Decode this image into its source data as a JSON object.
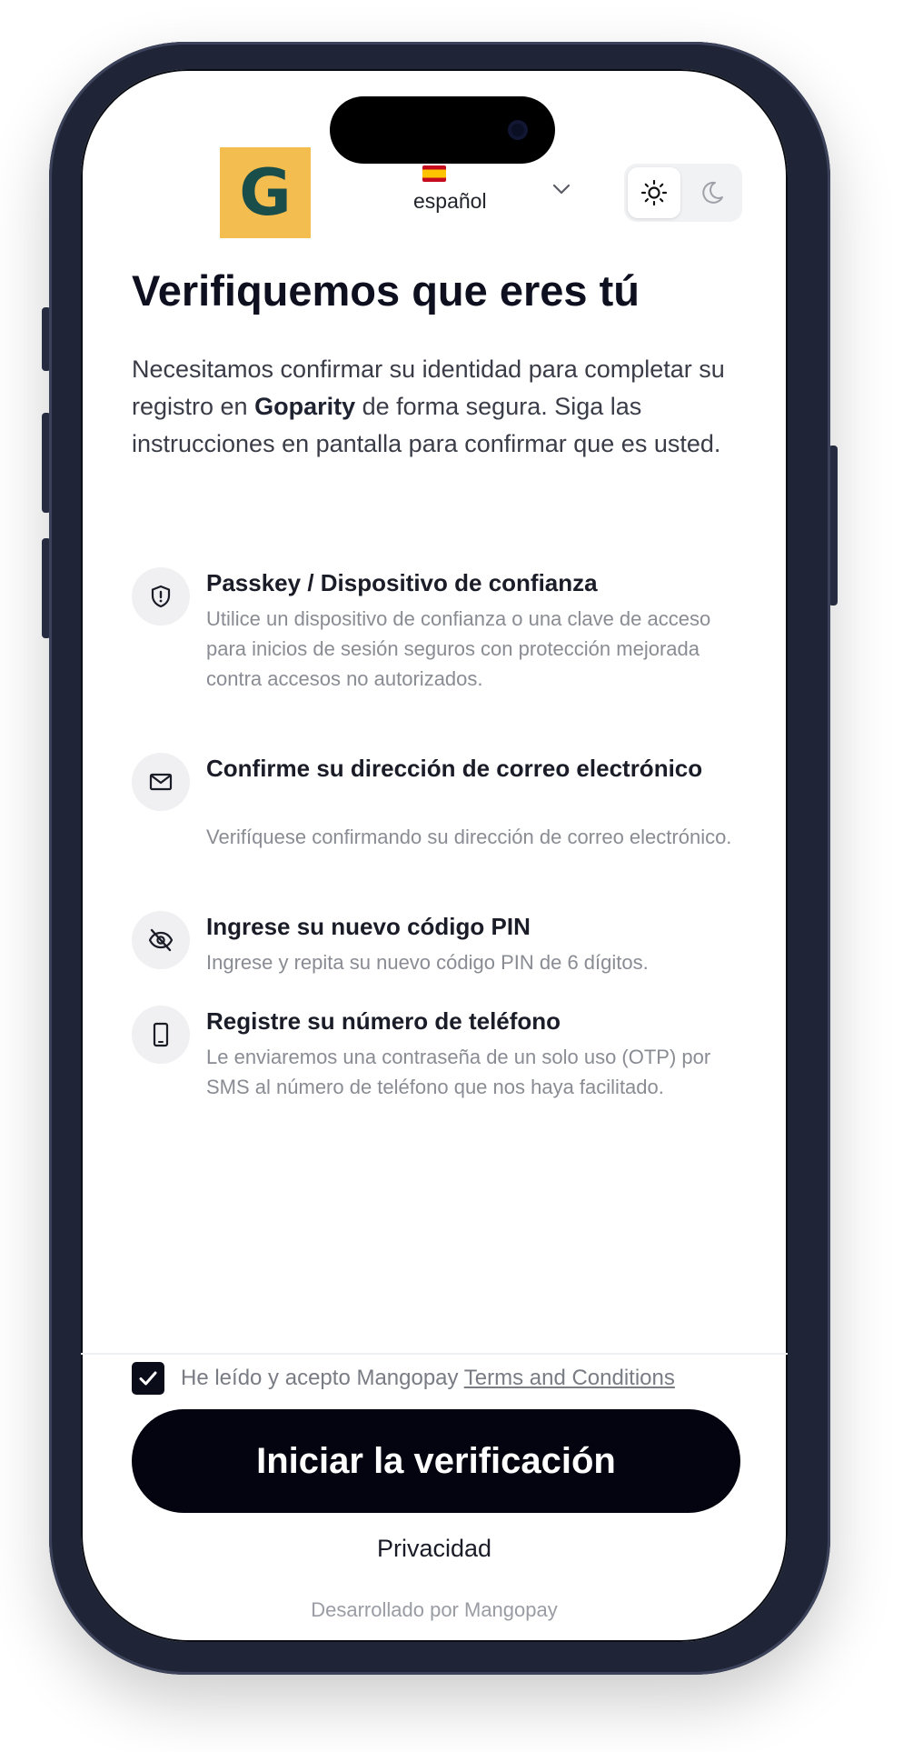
{
  "header": {
    "logo_letter": "G",
    "language": {
      "flag": "spain-flag-icon",
      "label": "español"
    },
    "theme_toggle": {
      "light_icon": "sun-icon",
      "dark_icon": "moon-icon",
      "active": "light"
    }
  },
  "main": {
    "title": "Verifiquemos que eres tú",
    "intro_before": "Necesitamos confirmar su identidad para completar su registro en ",
    "intro_brand": "Goparity",
    "intro_after": " de forma segura. Siga las instrucciones en pantalla para confirmar que es usted.",
    "steps": [
      {
        "icon": "shield-icon",
        "title": "Passkey / Dispositivo de confianza",
        "description": "Utilice un dispositivo de confianza o una clave de acceso para inicios de sesión seguros con protección mejorada contra accesos no autorizados."
      },
      {
        "icon": "mail-icon",
        "title": "Confirme su dirección de correo electrónico",
        "description": "Verifíquese confirmando su dirección de correo electrónico."
      },
      {
        "icon": "eye-off-icon",
        "title": "Ingrese su nuevo código PIN",
        "description": "Ingrese y repita su nuevo código PIN de 6 dígitos."
      },
      {
        "icon": "phone-icon",
        "title": "Registre su número de teléfono",
        "description": "Le enviaremos una contraseña de un solo uso (OTP) por SMS al número de teléfono que nos haya facilitado."
      }
    ]
  },
  "footer": {
    "terms_checked": true,
    "terms_text": "He leído y acepto Mangopay ",
    "terms_link": "Terms and Conditions",
    "cta_label": "Iniciar la verificación",
    "privacy_label": "Privacidad",
    "powered_by": "Desarrollado por Mangopay"
  }
}
